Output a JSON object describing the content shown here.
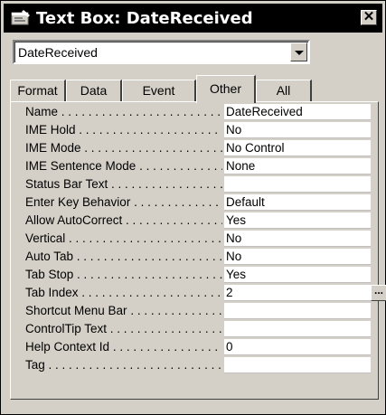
{
  "window": {
    "title": "Text Box: DateReceived",
    "icon": "text-box-properties-icon",
    "close_glyph": "✕"
  },
  "selector": {
    "value": "DateReceived"
  },
  "tabs": [
    {
      "label": "Format",
      "active": false
    },
    {
      "label": "Data",
      "active": false
    },
    {
      "label": "Event",
      "active": false
    },
    {
      "label": "Other",
      "active": true
    },
    {
      "label": "All",
      "active": false
    }
  ],
  "properties": [
    {
      "label": "Name",
      "value": "DateReceived"
    },
    {
      "label": "IME Hold",
      "value": "No"
    },
    {
      "label": "IME Mode",
      "value": "No Control"
    },
    {
      "label": "IME Sentence Mode",
      "value": "None"
    },
    {
      "label": "Status Bar Text",
      "value": ""
    },
    {
      "label": "Enter Key Behavior",
      "value": "Default"
    },
    {
      "label": "Allow AutoCorrect",
      "value": "Yes"
    },
    {
      "label": "Vertical",
      "value": "No"
    },
    {
      "label": "Auto Tab",
      "value": "No"
    },
    {
      "label": "Tab Stop",
      "value": "Yes"
    },
    {
      "label": "Tab Index",
      "value": "2",
      "builder": "..."
    },
    {
      "label": "Shortcut Menu Bar",
      "value": ""
    },
    {
      "label": "ControlTip Text",
      "value": ""
    },
    {
      "label": "Help Context Id",
      "value": "0"
    },
    {
      "label": "Tag",
      "value": ""
    }
  ]
}
